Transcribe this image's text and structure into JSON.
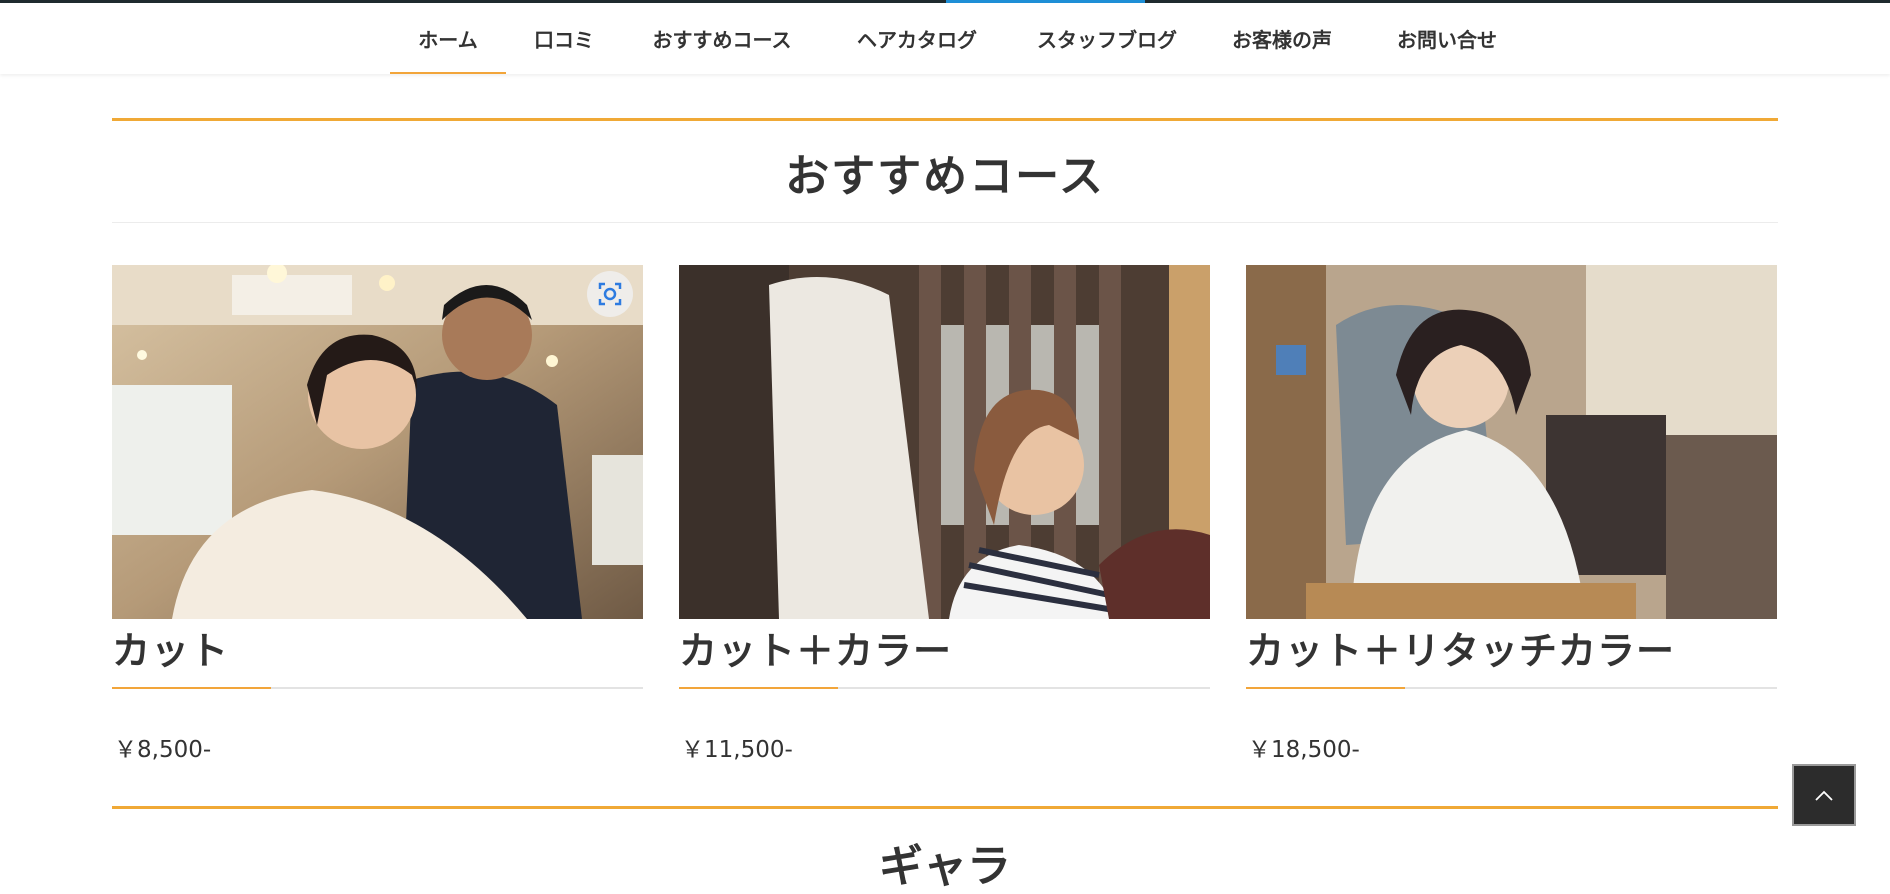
{
  "nav": {
    "items": [
      {
        "label": "ホーム",
        "active": true
      },
      {
        "label": "口コミ",
        "active": false
      },
      {
        "label": "おすすめコース",
        "active": false
      },
      {
        "label": "ヘアカタログ",
        "active": false
      },
      {
        "label": "スタッフブログ",
        "active": false
      },
      {
        "label": "お客様の声",
        "active": false
      },
      {
        "label": "お問い合せ",
        "active": false
      }
    ]
  },
  "section": {
    "title": "おすすめコース"
  },
  "courses": [
    {
      "title": "カット",
      "price": "￥8,500-"
    },
    {
      "title": "カット＋カラー",
      "price": "￥11,500-"
    },
    {
      "title": "カット＋リタッチカラー",
      "price": "￥18,500-"
    }
  ],
  "next_section": {
    "title": "ギャラ"
  },
  "colors": {
    "accent": "#f0a936",
    "nav_highlight": "#1e8fd6",
    "text": "#333333"
  },
  "icons": {
    "lens": "visual-search-icon",
    "back_to_top": "chevron-up-icon"
  }
}
